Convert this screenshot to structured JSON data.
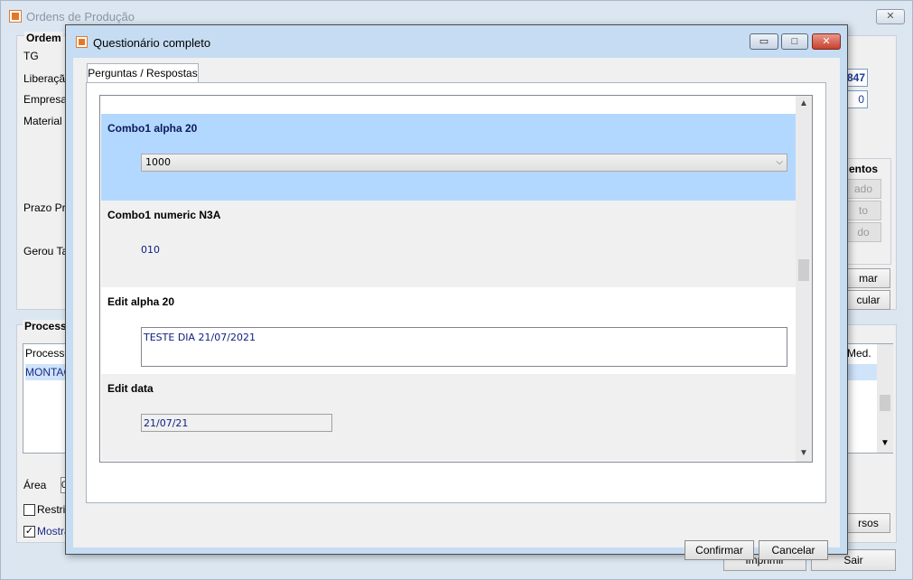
{
  "background": {
    "window_title": "Ordens de Produção",
    "close_glyph": "✕",
    "ordem_group": {
      "title": "Ordem",
      "labels": [
        "TG",
        "Liberação",
        "Empresa",
        "Material",
        "Prazo Prog",
        "Gerou Talã"
      ],
      "values": {
        "number": "847",
        "zero": "0"
      }
    },
    "eventos_group": {
      "title": "entos",
      "buttons": [
        "ado",
        "to",
        "do"
      ]
    },
    "side_buttons": [
      "mar",
      "cular"
    ],
    "processo_group": {
      "title": "Processo",
      "grid_header_left": "Processo",
      "grid_header_right": "Med.",
      "grid_first_row": "MONTAGE"
    },
    "area_label": "Área",
    "area_value": "0",
    "restrit_label": "Restrit",
    "mostra_label": "Mostra",
    "rsos_button": "rsos",
    "imprimir_button": "Imprimir",
    "sair_button": "Sair"
  },
  "dialog": {
    "title": "Questionário completo",
    "minimize_glyph": "▭",
    "maximize_glyph": "□",
    "close_glyph": "✕",
    "tab_label": "Perguntas / Respostas",
    "questions": [
      {
        "label": "Combo1 alpha 20",
        "type": "combo",
        "value": "1000",
        "selected": true
      },
      {
        "label": "Combo1 numeric N3A",
        "type": "text",
        "value": "010"
      },
      {
        "label": "Edit alpha 20",
        "type": "memo",
        "value": "TESTE DIA 21/07/2021"
      },
      {
        "label": "Edit data",
        "type": "date",
        "value": "21/07/21"
      }
    ],
    "scroll_up": "▲",
    "scroll_down": "▼",
    "confirm_button": "Confirmar",
    "cancel_button": "Cancelar"
  }
}
